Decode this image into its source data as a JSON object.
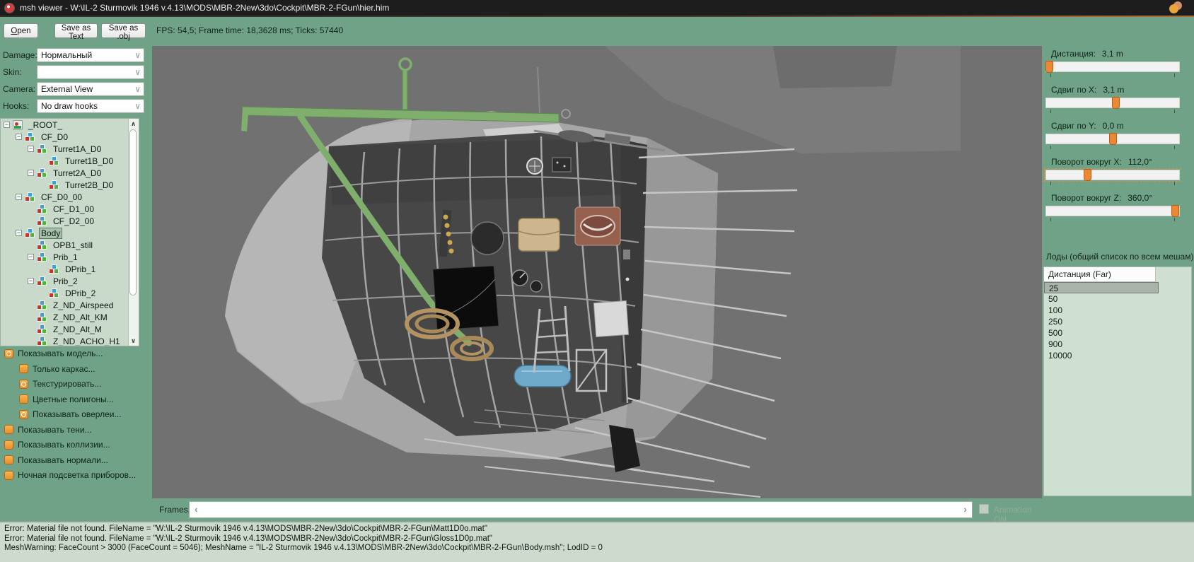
{
  "window": {
    "title": "msh viewer - W:\\IL-2 Sturmovik 1946 v.4.13\\MODS\\MBR-2New\\3do\\Cockpit\\MBR-2-FGun\\hier.him"
  },
  "toolbar": {
    "open_label": "Open",
    "save_text_label": "Save as Text",
    "save_obj_label": "Save as .obj",
    "stats": "FPS: 54,5; Frame time: 18,3628 ms; Ticks: 57440"
  },
  "left_panel": {
    "selectors": [
      {
        "id": "damage",
        "label": "Damage:",
        "value": "Нормальный"
      },
      {
        "id": "skin",
        "label": "Skin:",
        "value": ""
      },
      {
        "id": "camera",
        "label": "Camera:",
        "value": "External View"
      },
      {
        "id": "hooks",
        "label": "Hooks:",
        "value": "No draw hooks"
      }
    ],
    "tree": [
      {
        "label": "_ROOT_",
        "level": 0,
        "expandable": true,
        "icon": "root",
        "selected": false
      },
      {
        "label": "CF_D0",
        "level": 1,
        "expandable": true,
        "selected": false
      },
      {
        "label": "Turret1A_D0",
        "level": 2,
        "expandable": true,
        "selected": false
      },
      {
        "label": "Turret1B_D0",
        "level": 3,
        "expandable": false,
        "selected": false
      },
      {
        "label": "Turret2A_D0",
        "level": 2,
        "expandable": true,
        "selected": false
      },
      {
        "label": "Turret2B_D0",
        "level": 3,
        "expandable": false,
        "selected": false
      },
      {
        "label": "CF_D0_00",
        "level": 1,
        "expandable": true,
        "selected": false
      },
      {
        "label": "CF_D1_00",
        "level": 2,
        "expandable": false,
        "selected": false
      },
      {
        "label": "CF_D2_00",
        "level": 2,
        "expandable": false,
        "selected": false
      },
      {
        "label": "Body",
        "level": 1,
        "expandable": true,
        "selected": true
      },
      {
        "label": "OPB1_still",
        "level": 2,
        "expandable": false,
        "selected": false
      },
      {
        "label": "Prib_1",
        "level": 2,
        "expandable": true,
        "selected": false
      },
      {
        "label": "DPrib_1",
        "level": 3,
        "expandable": false,
        "selected": false
      },
      {
        "label": "Prib_2",
        "level": 2,
        "expandable": true,
        "selected": false
      },
      {
        "label": "DPrib_2",
        "level": 3,
        "expandable": false,
        "selected": false
      },
      {
        "label": "Z_ND_Airspeed",
        "level": 2,
        "expandable": false,
        "selected": false
      },
      {
        "label": "Z_ND_Alt_KM",
        "level": 2,
        "expandable": false,
        "selected": false
      },
      {
        "label": "Z_ND_Alt_M",
        "level": 2,
        "expandable": false,
        "selected": false
      },
      {
        "label": "Z_ND_ACHO_H1",
        "level": 2,
        "expandable": false,
        "selected": false
      }
    ],
    "checkboxes": [
      {
        "label": "Показывать модель...",
        "checked": true,
        "indent": 0
      },
      {
        "label": "Только каркас...",
        "checked": false,
        "indent": 1
      },
      {
        "label": "Текстурировать...",
        "checked": true,
        "indent": 1
      },
      {
        "label": "Цветные полигоны...",
        "checked": false,
        "indent": 1
      },
      {
        "label": "Показывать оверлеи...",
        "checked": true,
        "indent": 1
      },
      {
        "label": "Показывать тени...",
        "checked": false,
        "indent": 0
      },
      {
        "label": "Показывать коллизии...",
        "checked": false,
        "indent": 0
      },
      {
        "label": "Показывать нормали...",
        "checked": false,
        "indent": 0
      },
      {
        "label": "Ночная подсветка приборов...",
        "checked": false,
        "indent": 0
      }
    ]
  },
  "right_panel": {
    "sliders": [
      {
        "label": "Дистанция:",
        "value": "3,1 m",
        "position_pct": 2,
        "focused": false
      },
      {
        "label": "Сдвиг по X:",
        "value": "3,1 m",
        "position_pct": 52,
        "focused": false
      },
      {
        "label": "Сдвиг по Y:",
        "value": "0,0 m",
        "position_pct": 50,
        "focused": false
      },
      {
        "label": "Поворот вокруг X:",
        "value": "112,0°",
        "position_pct": 31,
        "focused": true
      },
      {
        "label": "Поворот вокруг Z:",
        "value": "360,0°",
        "position_pct": 97,
        "focused": false
      }
    ],
    "lods": {
      "title": "Лоды (общий список по всем мешам):",
      "header": "Дистанция (Far)",
      "rows": [
        "25",
        "50",
        "100",
        "250",
        "500",
        "900",
        "10000"
      ],
      "selected_index": 0
    }
  },
  "bottom_bar": {
    "frames_label": "Frames:",
    "animation_label": "Animation ON",
    "animation_enabled": false
  },
  "log": {
    "lines": [
      "Error: Material file not found. FileName = \"W:\\IL-2 Sturmovik 1946 v.4.13\\MODS\\MBR-2New\\3do\\Cockpit\\MBR-2-FGun\\Matt1D0o.mat\"",
      "Error: Material file not found. FileName = \"W:\\IL-2 Sturmovik 1946 v.4.13\\MODS\\MBR-2New\\3do\\Cockpit\\MBR-2-FGun\\Gloss1D0p.mat\"",
      "MeshWarning: FaceCount > 3000 (FaceCount = 5046); MeshName = \"IL-2 Sturmovik 1946 v.4.13\\MODS\\MBR-2New\\3do\\Cockpit\\MBR-2-FGun\\Body.msh\"; LodID = 0"
    ]
  },
  "glyphs": {
    "down": "∨",
    "up": "∧",
    "left": "‹",
    "right": "›",
    "minus": "−"
  },
  "colors": {
    "teal_bg": "#6fa287",
    "panel_bg": "#c9dacb",
    "list_bg": "#cfdfd2",
    "selected_row": "#a9b3aa",
    "accent_orange": "#e98936",
    "title_bg": "#1d1d1d",
    "viewport_bg": "#717171",
    "log_bg": "#ccdbce",
    "hook_green": "#7fae6d"
  }
}
